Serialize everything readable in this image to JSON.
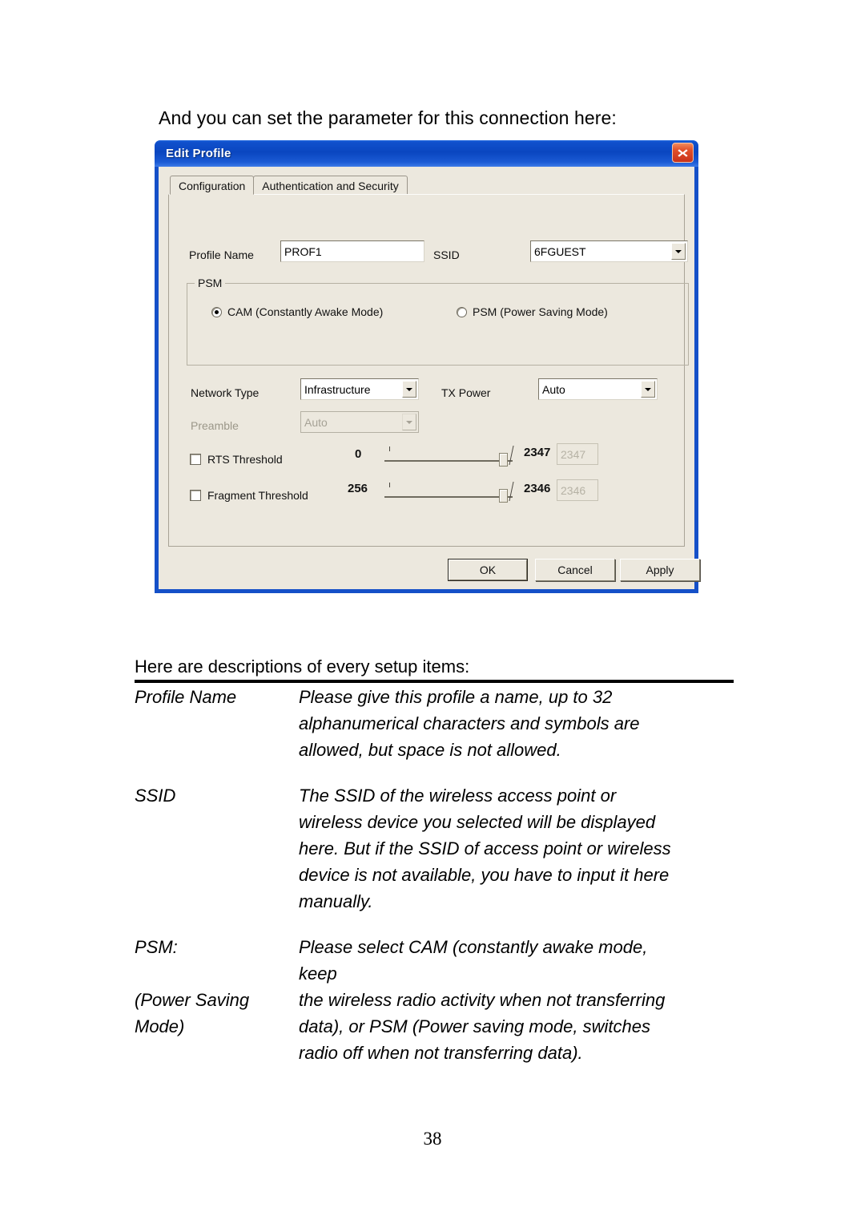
{
  "document": {
    "intro": "And you can set the parameter for this connection here:",
    "section_title": "Here are descriptions of every setup items:",
    "page_number": "38",
    "descriptions": [
      {
        "term_lines": [
          "Profile Name"
        ],
        "def_lines": [
          "Please give this profile a name, up to 32",
          "alphanumerical characters and symbols are",
          "allowed, but space is not allowed."
        ]
      },
      {
        "term_lines": [
          "SSID"
        ],
        "def_lines": [
          "The SSID of the wireless access point or",
          "wireless device you selected will be displayed",
          "here. But if the SSID of access point or wireless",
          "device is not available, you have to input it here",
          "manually."
        ]
      },
      {
        "term_lines": [
          "PSM:",
          "(Power Saving",
          "Mode)"
        ],
        "def_lines": [
          "Please select CAM (constantly awake mode,",
          "keep",
          "the wireless radio activity when not transferring",
          "data), or PSM (Power saving mode, switches",
          "radio off when not transferring data)."
        ]
      }
    ]
  },
  "dialog": {
    "title": "Edit Profile",
    "close_icon": "close-icon",
    "tabs": [
      {
        "label": "Configuration",
        "active": true
      },
      {
        "label": "Authentication and Security",
        "active": false
      }
    ],
    "fields": {
      "profile_name_label": "Profile Name",
      "profile_name_value": "PROF1",
      "ssid_label": "SSID",
      "ssid_value": "6FGUEST",
      "network_type_label": "Network Type",
      "network_type_value": "Infrastructure",
      "tx_power_label": "TX Power",
      "tx_power_value": "Auto",
      "preamble_label": "Preamble",
      "preamble_value": "Auto"
    },
    "psm_group": {
      "legend": "PSM",
      "options": [
        {
          "label": "CAM (Constantly Awake Mode)",
          "selected": true
        },
        {
          "label": "PSM (Power Saving Mode)",
          "selected": false
        }
      ]
    },
    "thresholds": [
      {
        "label": "RTS Threshold",
        "checked": false,
        "min": "0",
        "max": "2347",
        "value": "2347"
      },
      {
        "label": "Fragment Threshold",
        "checked": false,
        "min": "256",
        "max": "2346",
        "value": "2346"
      }
    ],
    "buttons": {
      "ok": "OK",
      "cancel": "Cancel",
      "apply": "Apply"
    }
  },
  "colors": {
    "titlebar_blue": "#0a46c0",
    "dialog_face": "#ece8de",
    "close_red": "#c8321a",
    "field_white": "#ffffff"
  }
}
